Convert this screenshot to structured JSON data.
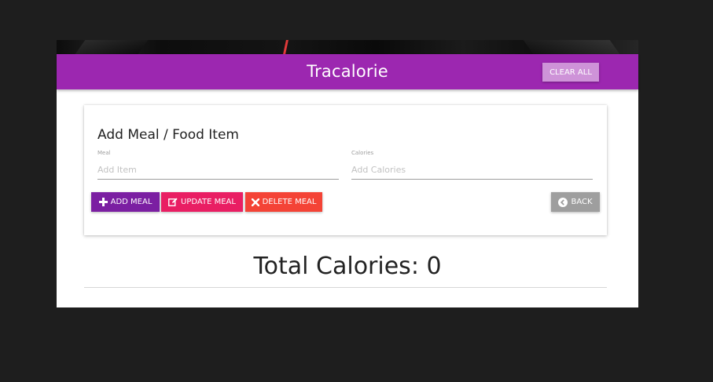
{
  "navbar": {
    "brand": "Tracalorie",
    "clear_all_label": "CLEAR ALL"
  },
  "form": {
    "title": "Add Meal / Food Item",
    "meal_label": "Meal",
    "meal_placeholder": "Add Item",
    "meal_value": "",
    "calories_label": "Calories",
    "calories_placeholder": "Add Calories",
    "calories_value": ""
  },
  "buttons": {
    "add_label": "ADD MEAL",
    "update_label": "UPDATE MEAL",
    "delete_label": "DELETE MEAL",
    "back_label": "BACK"
  },
  "icons": {
    "add": "plus-icon",
    "update": "edit-icon",
    "delete": "x-icon",
    "back": "chevron-left-circle-icon"
  },
  "totals": {
    "label": "Total Calories: 0"
  },
  "colors": {
    "primary": "#9c27b0",
    "primary_dark": "#7b1fa2",
    "primary_light": "#ce93d8",
    "update": "#e91e63",
    "delete": "#f44336",
    "back": "#9e9e9e"
  }
}
